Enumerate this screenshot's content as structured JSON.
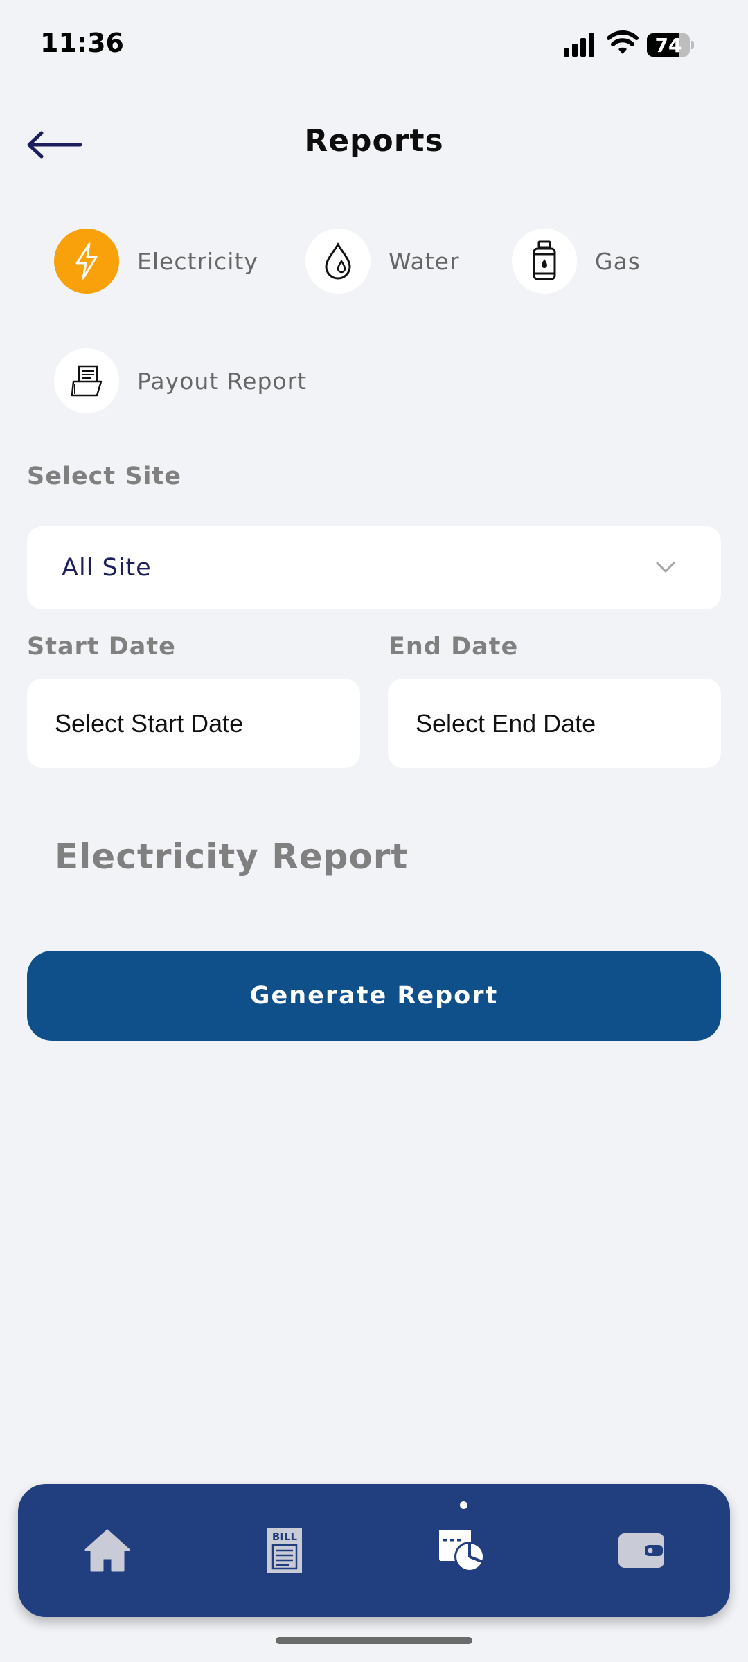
{
  "status_bar": {
    "time": "11:36",
    "battery_percent": "74",
    "battery_level": 0.74
  },
  "header": {
    "title": "Reports",
    "back_icon": "arrow-left-icon"
  },
  "utilities": [
    {
      "label": "Electricity",
      "icon": "lightning-bolt-icon",
      "active": true
    },
    {
      "label": "Water",
      "icon": "water-drop-icon",
      "active": false
    },
    {
      "label": "Gas",
      "icon": "gas-cylinder-icon",
      "active": false
    },
    {
      "label": "Payout Report",
      "icon": "payout-report-icon",
      "active": false
    }
  ],
  "site": {
    "label": "Select Site",
    "value": "All Site",
    "icon": "chevron-down-icon"
  },
  "start_date": {
    "label": "Start Date",
    "placeholder": "Select Start Date"
  },
  "end_date": {
    "label": "End Date",
    "placeholder": "Select End Date"
  },
  "report_title": "Electricity Report",
  "generate_button": "Generate Report",
  "bottom_nav": [
    {
      "name": "home",
      "icon": "home-icon",
      "active": false
    },
    {
      "name": "bill",
      "icon": "bill-icon",
      "icon_text": "BILL",
      "active": false
    },
    {
      "name": "reports",
      "icon": "reports-chart-icon",
      "active": true
    },
    {
      "name": "wallet",
      "icon": "wallet-icon",
      "active": false
    }
  ],
  "colors": {
    "background": "#f2f3f7",
    "accent_orange": "#f9a10a",
    "primary_button": "#0f4f8a",
    "nav_background": "#213e7e",
    "nav_icon_inactive": "#c9ccd6",
    "select_text": "#1d1f5c"
  }
}
